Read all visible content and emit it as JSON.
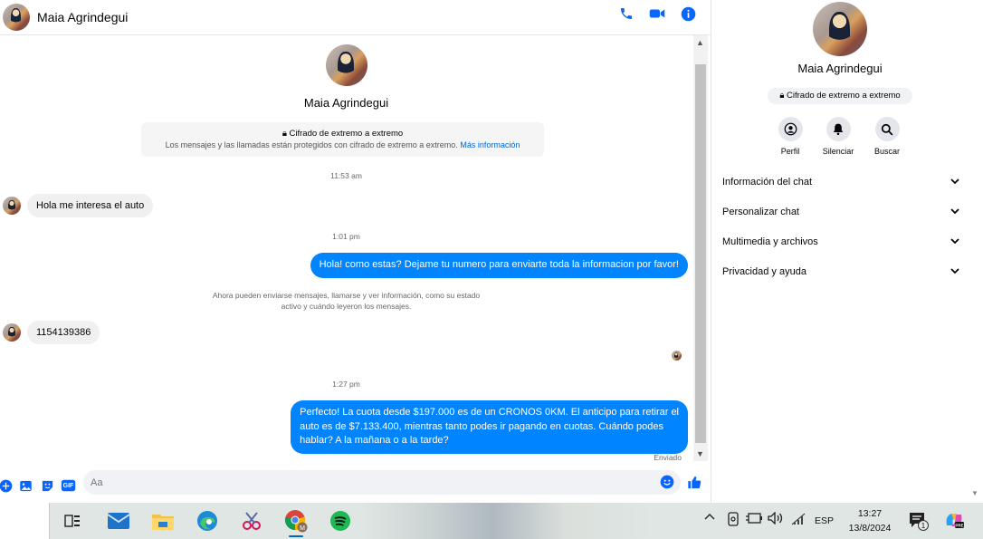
{
  "contact": {
    "name": "Maia Agrindegui"
  },
  "header": {
    "call_icon": "phone-icon",
    "video_icon": "video-icon",
    "info_icon": "info-icon"
  },
  "e2e": {
    "title": "Cifrado de extremo a extremo",
    "description": "Los mensajes y las llamadas están protegidos con cifrado de extremo a extremo.",
    "link": "Más información"
  },
  "messages": {
    "ts1": "11:53 am",
    "m1": "Hola me interesa el auto",
    "ts2": "1:01 pm",
    "m2": "Hola! como estas? Dejame tu numero para enviarte toda la informacion por favor!",
    "note_line1": "Ahora pueden enviarse mensajes, llamarse y ver información, como su estado",
    "note_line2": "activo y cuándo leyeron los mensajes.",
    "m3": "1154139386",
    "ts3": "1:27 pm",
    "m4_line1": "Perfecto! La cuota desde $197.000 es de un CRONOS 0KM. El anticipo para retirar el",
    "m4_line2": "auto es de $7.133.400, mientras tanto podes ir pagando en cuotas. Cuándo podes",
    "m4_line3": "hablar? A la mañana o a la tarde?",
    "status": "Enviado"
  },
  "composer": {
    "placeholder": "Aa",
    "gif_label": "GIF"
  },
  "panel": {
    "name": "Maia Agrindegui",
    "e2e_pill": "Cifrado de extremo a extremo",
    "buttons": [
      {
        "label": "Perfil",
        "icon": "profile-icon"
      },
      {
        "label": "Silenciar",
        "icon": "bell-icon"
      },
      {
        "label": "Buscar",
        "icon": "search-icon"
      }
    ],
    "sections": [
      "Información del chat",
      "Personalizar chat",
      "Multimedia y archivos",
      "Privacidad y ayuda"
    ]
  },
  "taskbar": {
    "lang": "ESP",
    "time": "13:27",
    "date": "13/8/2024",
    "notification_count": "1"
  },
  "colors": {
    "accent": "#0084ff",
    "icon_blue": "#0866ff",
    "bubble_in": "#f0f0f0"
  }
}
